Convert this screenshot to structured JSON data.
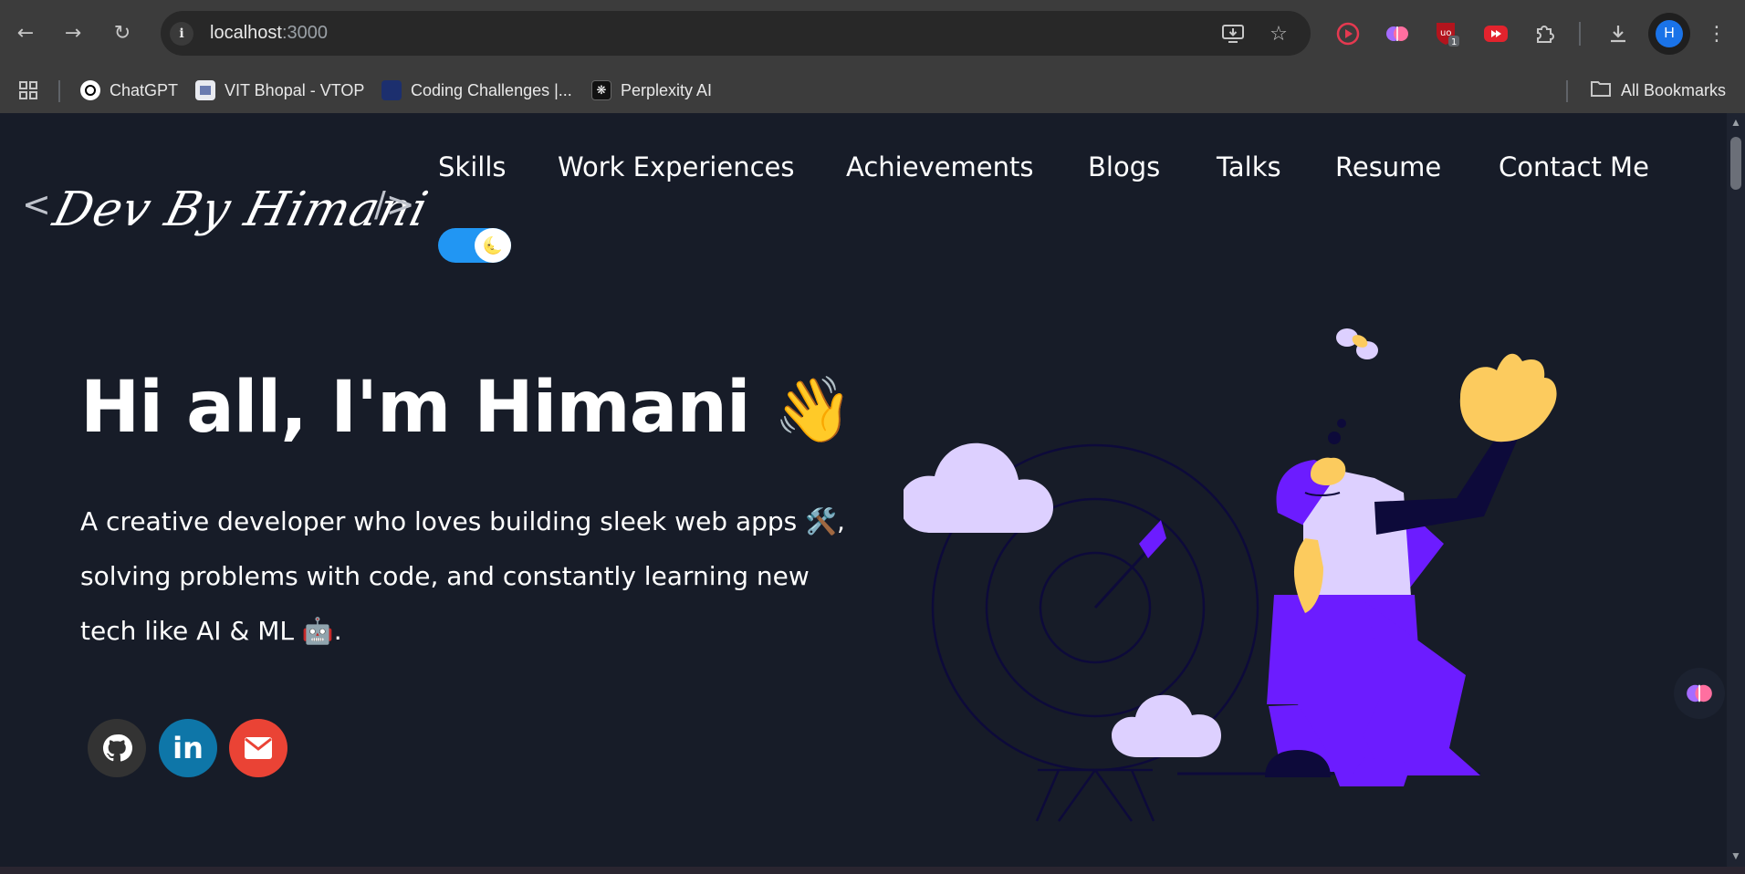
{
  "browser": {
    "url_host": "localhost",
    "url_port": ":3000",
    "ext_badge": "1",
    "profile_initial": "H",
    "bookmarks": [
      {
        "label": "ChatGPT"
      },
      {
        "label": "VIT Bhopal - VTOP"
      },
      {
        "label": "Coding Challenges |..."
      },
      {
        "label": "Perplexity AI"
      }
    ],
    "all_bookmarks": "All Bookmarks"
  },
  "site": {
    "logo_open": "<",
    "logo_text": "Dev By Himani",
    "logo_close": "/>",
    "nav": [
      "Skills",
      "Work Experiences",
      "Achievements",
      "Blogs",
      "Talks",
      "Resume",
      "Contact Me"
    ],
    "theme_toggle_on": true,
    "greeting": "Hi all, I'm Himani",
    "greeting_emoji": "👋",
    "subtitle": "A creative developer who loves building sleek web apps 🛠️, solving problems with code, and constantly learning new tech like AI & ML 🤖.",
    "socials": [
      {
        "name": "GitHub",
        "color": "#333333",
        "icon": "github-icon"
      },
      {
        "name": "LinkedIn",
        "color": "#0e76a8",
        "icon": "linkedin-icon"
      },
      {
        "name": "Email",
        "color": "#ea4335",
        "icon": "mail-icon"
      }
    ]
  },
  "colors": {
    "bg": "#171c28",
    "accent_purple": "#6c1cff",
    "toggle_blue": "#2196f3",
    "cloud": "#ddd0ff",
    "skin": "#fccb5e"
  }
}
